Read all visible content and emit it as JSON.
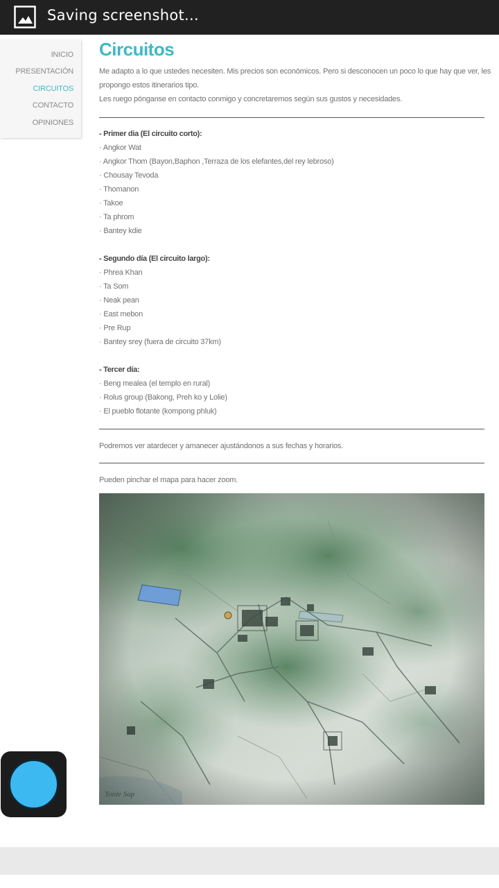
{
  "status_bar": {
    "message": "Saving screenshot...",
    "icon": "screenshot-icon"
  },
  "nav": {
    "items": [
      {
        "label": "INICIO",
        "active": false
      },
      {
        "label": "PRESENTACIÓN",
        "active": false
      },
      {
        "label": "CIRCUITOS",
        "active": true
      },
      {
        "label": "CONTACTO",
        "active": false
      },
      {
        "label": "OPINIONES",
        "active": false
      }
    ]
  },
  "page": {
    "title": "Circuitos",
    "intro": [
      "Me adapto a lo que ustedes necesiten. Mis precios son económicos. Pero si desconocen un poco lo que hay que ver, les",
      "propongo estos itinerarios tipo.",
      "Les ruego pónganse en contacto conmigo y concretaremos según sus gustos y necesidades."
    ],
    "day1": {
      "heading": "- Primer dia (El circuito corto):",
      "items": [
        "· Angkor Wat",
        "· Angkor Thom (Bayon,Baphon ,Terraza de los elefantes,del rey lebroso)",
        "· Chousay Tevoda",
        "· Thomanon",
        "· Takoe",
        "· Ta phrom",
        "· Bantey kdie"
      ]
    },
    "day2": {
      "heading": "- Segundo día (El circuito largo):",
      "items": [
        "· Phrea Khan",
        "· Ta Som",
        "· Neak pean",
        "· East mebon",
        "· Pre Rup",
        "· Bantey srey (fuera de circuito 37km)"
      ]
    },
    "day3": {
      "heading": "- Tercer día:",
      "items": [
        "· Beng mealea (el templo en rural)",
        "· Rolus group (Bakong, Preh ko y Lolie)",
        "· El pueblo flotante (kompong phluk)"
      ]
    },
    "sunset_note": "Podremos ver atardecer y amanecer ajustándonos a sus fechas y horarios.",
    "map_note": "Pueden pinchar el mapa para hacer zoom.",
    "map": {
      "label_tonle_sap": "Tonle Sap"
    }
  },
  "colors": {
    "accent": "#3fb8c4",
    "status_bar": "#212121",
    "floating_button": "#3cb9f0"
  }
}
